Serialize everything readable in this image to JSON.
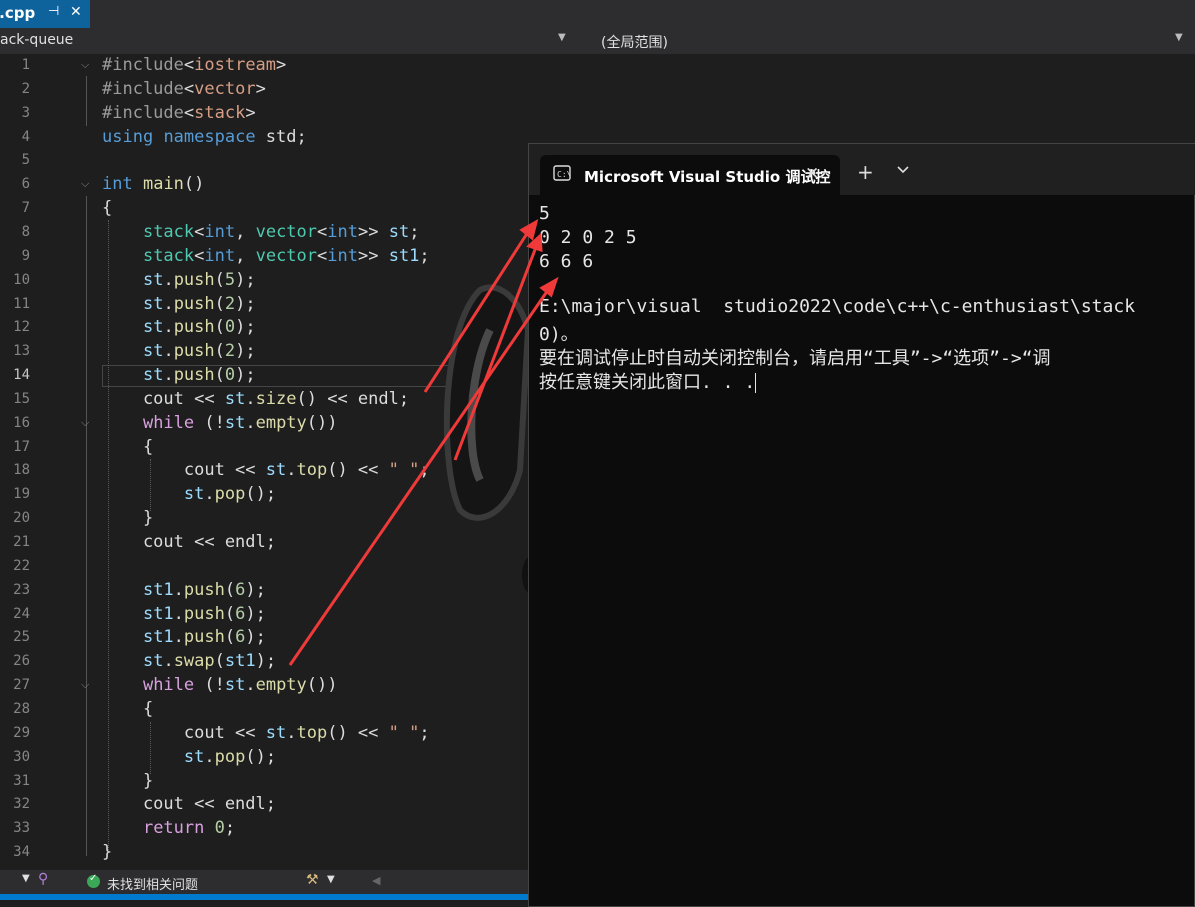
{
  "tab": {
    "label": "t.cpp",
    "pin_icon": "pin-icon",
    "close_icon": "close-icon"
  },
  "nav": {
    "left": "ack-queue",
    "right": "(全局范围)"
  },
  "editor": {
    "current_line": 14,
    "lines": [
      {
        "n": "1",
        "code": "#include<iostream>"
      },
      {
        "n": "2",
        "code": "#include<vector>"
      },
      {
        "n": "3",
        "code": "#include<stack>"
      },
      {
        "n": "4",
        "code": "using namespace std;"
      },
      {
        "n": "5",
        "code": ""
      },
      {
        "n": "6",
        "code": "int main()"
      },
      {
        "n": "7",
        "code": "{"
      },
      {
        "n": "8",
        "code": "    stack<int, vector<int>> st;"
      },
      {
        "n": "9",
        "code": "    stack<int, vector<int>> st1;"
      },
      {
        "n": "10",
        "code": "    st.push(5);"
      },
      {
        "n": "11",
        "code": "    st.push(2);"
      },
      {
        "n": "12",
        "code": "    st.push(0);"
      },
      {
        "n": "13",
        "code": "    st.push(2);"
      },
      {
        "n": "14",
        "code": "    st.push(0);"
      },
      {
        "n": "15",
        "code": "    cout << st.size() << endl;"
      },
      {
        "n": "16",
        "code": "    while (!st.empty())"
      },
      {
        "n": "17",
        "code": "    {"
      },
      {
        "n": "18",
        "code": "        cout << st.top() << \" \";"
      },
      {
        "n": "19",
        "code": "        st.pop();"
      },
      {
        "n": "20",
        "code": "    }"
      },
      {
        "n": "21",
        "code": "    cout << endl;"
      },
      {
        "n": "22",
        "code": ""
      },
      {
        "n": "23",
        "code": "    st1.push(6);"
      },
      {
        "n": "24",
        "code": "    st1.push(6);"
      },
      {
        "n": "25",
        "code": "    st1.push(6);"
      },
      {
        "n": "26",
        "code": "    st.swap(st1);"
      },
      {
        "n": "27",
        "code": "    while (!st.empty())"
      },
      {
        "n": "28",
        "code": "    {"
      },
      {
        "n": "29",
        "code": "        cout << st.top() << \" \";"
      },
      {
        "n": "30",
        "code": "        st.pop();"
      },
      {
        "n": "31",
        "code": "    }"
      },
      {
        "n": "32",
        "code": "    cout << endl;"
      },
      {
        "n": "33",
        "code": "    return 0;"
      },
      {
        "n": "34",
        "code": "}"
      }
    ]
  },
  "status": {
    "issues": "未找到相关问题"
  },
  "terminal": {
    "title": "Microsoft Visual Studio 调试控",
    "output": [
      "5",
      "0 2 0 2 5",
      "6 6 6",
      "",
      "E:\\major\\visual  studio2022\\code\\c++\\c-enthusiast\\stack",
      "0)。",
      "要在调试停止时自动关闭控制台，请启用“工具”->“选项”->“调",
      "按任意键关闭此窗口. . ."
    ]
  },
  "colors": {
    "keyword": "#569cd6",
    "preprocessor": "#d8a0df",
    "type": "#4ec9b0",
    "function": "#dcdcaa",
    "variable": "#9cdcfe",
    "number": "#b5cea8",
    "string": "#d69d85",
    "annotation_arrow": "#f03a3a"
  }
}
